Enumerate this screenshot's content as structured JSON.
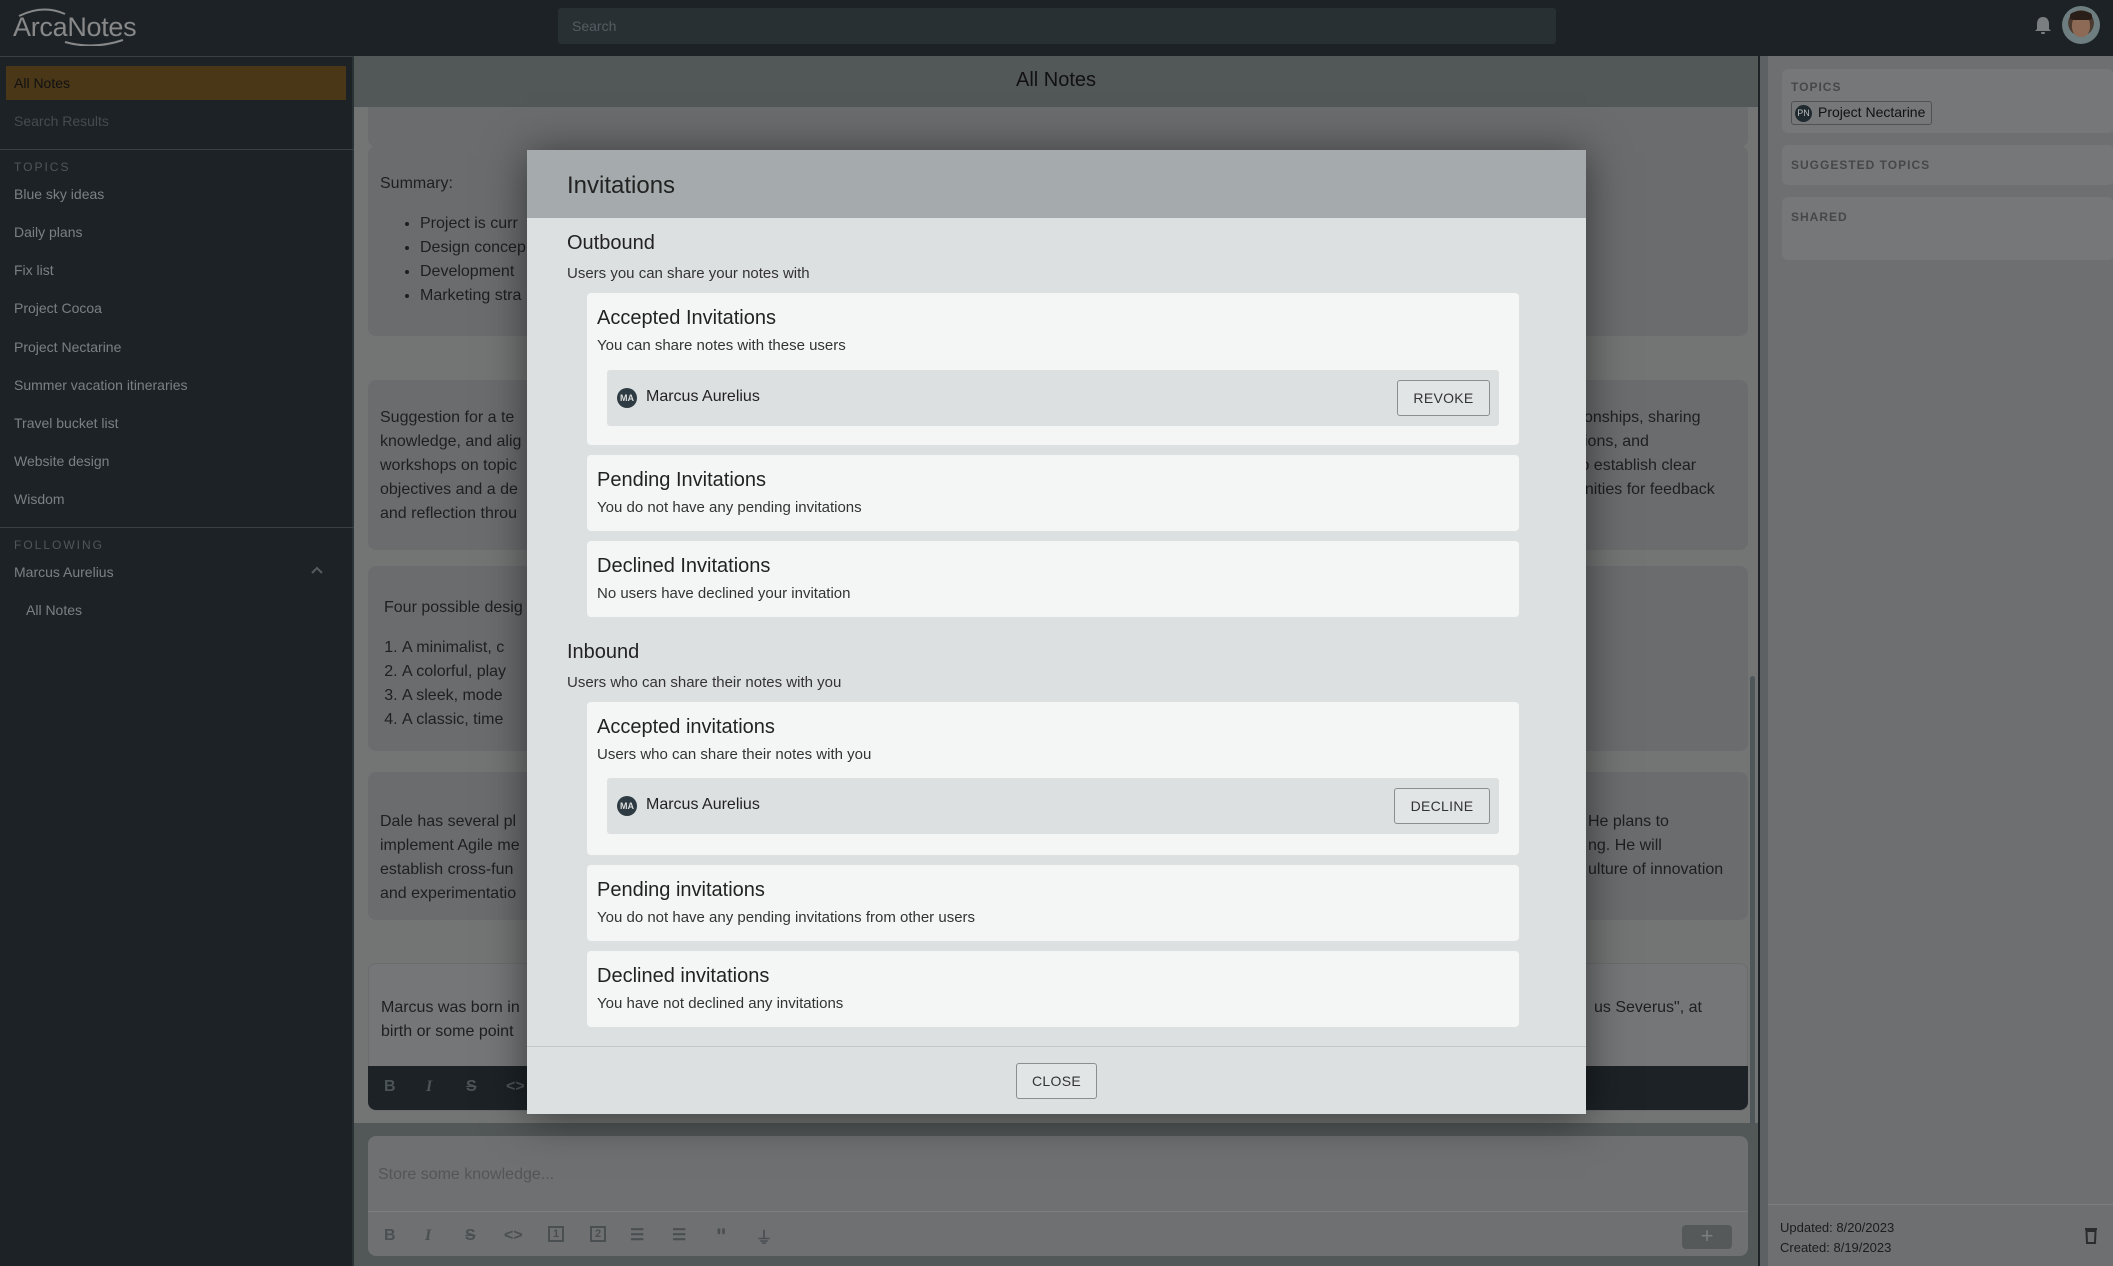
{
  "app": {
    "name": "ArcaNotes"
  },
  "topbar": {
    "search_placeholder": "Search",
    "bell_icon": "bell-icon",
    "avatar_icon": "user-avatar"
  },
  "sidebar": {
    "nav": [
      {
        "label": "All Notes",
        "active": true
      },
      {
        "label": "Search Results",
        "active": false
      }
    ],
    "topics_heading": "TOPICS",
    "topics": [
      "Blue sky ideas",
      "Daily plans",
      "Fix list",
      "Project Cocoa",
      "Project Nectarine",
      "Summer vacation itineraries",
      "Travel bucket list",
      "Website design",
      "Wisdom"
    ],
    "following_heading": "FOLLOWING",
    "following": [
      {
        "name": "Marcus Aurelius",
        "expanded": true,
        "children": [
          "All Notes"
        ]
      }
    ]
  },
  "main": {
    "title": "All Notes",
    "notes": [
      {
        "summary_label": "Summary:",
        "bullets": [
          "Project is curr",
          "Design concep",
          "Development",
          "Marketing stra"
        ]
      },
      {
        "left_lines": [
          "Suggestion for a te",
          "knowledge, and alig",
          "workshops on topic",
          "objectives and a de",
          "and reflection throu"
        ],
        "right_lines": [
          "tionships, sharing",
          "sions, and",
          "to establish clear",
          "unities for feedback"
        ]
      },
      {
        "intro": "Four possible desig",
        "items": [
          "A minimalist, c",
          "A colorful, play",
          "A sleek, mode",
          "A classic, time"
        ]
      },
      {
        "left_lines": [
          "Dale has several pl",
          "implement Agile me",
          "establish cross-fun",
          "and experimentatio"
        ],
        "right_lines": [
          "He plans to",
          "ng. He will",
          "ulture of innovation"
        ]
      },
      {
        "left_lines": [
          "Marcus was born in",
          "birth or some point"
        ],
        "right_lines": [
          "us Severus\", at"
        ]
      }
    ],
    "editor_toolbar": [
      "bold",
      "italic",
      "strikethrough",
      "code"
    ],
    "new_note": {
      "placeholder": "Store some knowledge...",
      "toolbar": [
        "bold",
        "italic",
        "strikethrough",
        "code",
        "heading-1",
        "heading-2",
        "bullet-list",
        "numbered-list",
        "quote",
        "highlight"
      ],
      "add_label": "+"
    }
  },
  "right_panel": {
    "topics_label": "TOPICS",
    "topic_chip": {
      "initials": "PN",
      "label": "Project Nectarine"
    },
    "suggested_label": "SUGGESTED TOPICS",
    "shared_label": "SHARED",
    "updated": "Updated: 8/20/2023",
    "created": "Created: 8/19/2023"
  },
  "modal": {
    "title": "Invitations",
    "outbound": {
      "title": "Outbound",
      "subtitle": "Users you can share your notes with",
      "accepted": {
        "title": "Accepted Invitations",
        "subtitle": "You can share notes with these users",
        "users": [
          {
            "initials": "MA",
            "name": "Marcus Aurelius",
            "action": "REVOKE"
          }
        ]
      },
      "pending": {
        "title": "Pending Invitations",
        "subtitle": "You do not have any pending invitations"
      },
      "declined": {
        "title": "Declined Invitations",
        "subtitle": "No users have declined your invitation"
      }
    },
    "inbound": {
      "title": "Inbound",
      "subtitle": "Users who can share their notes with you",
      "accepted": {
        "title": "Accepted invitations",
        "subtitle": "Users who can share their notes with you",
        "users": [
          {
            "initials": "MA",
            "name": "Marcus Aurelius",
            "action": "DECLINE"
          }
        ]
      },
      "pending": {
        "title": "Pending invitations",
        "subtitle": "You do not have any pending invitations from other users"
      },
      "declined": {
        "title": "Declined invitations",
        "subtitle": "You have not declined any invitations"
      }
    },
    "close_label": "CLOSE"
  }
}
